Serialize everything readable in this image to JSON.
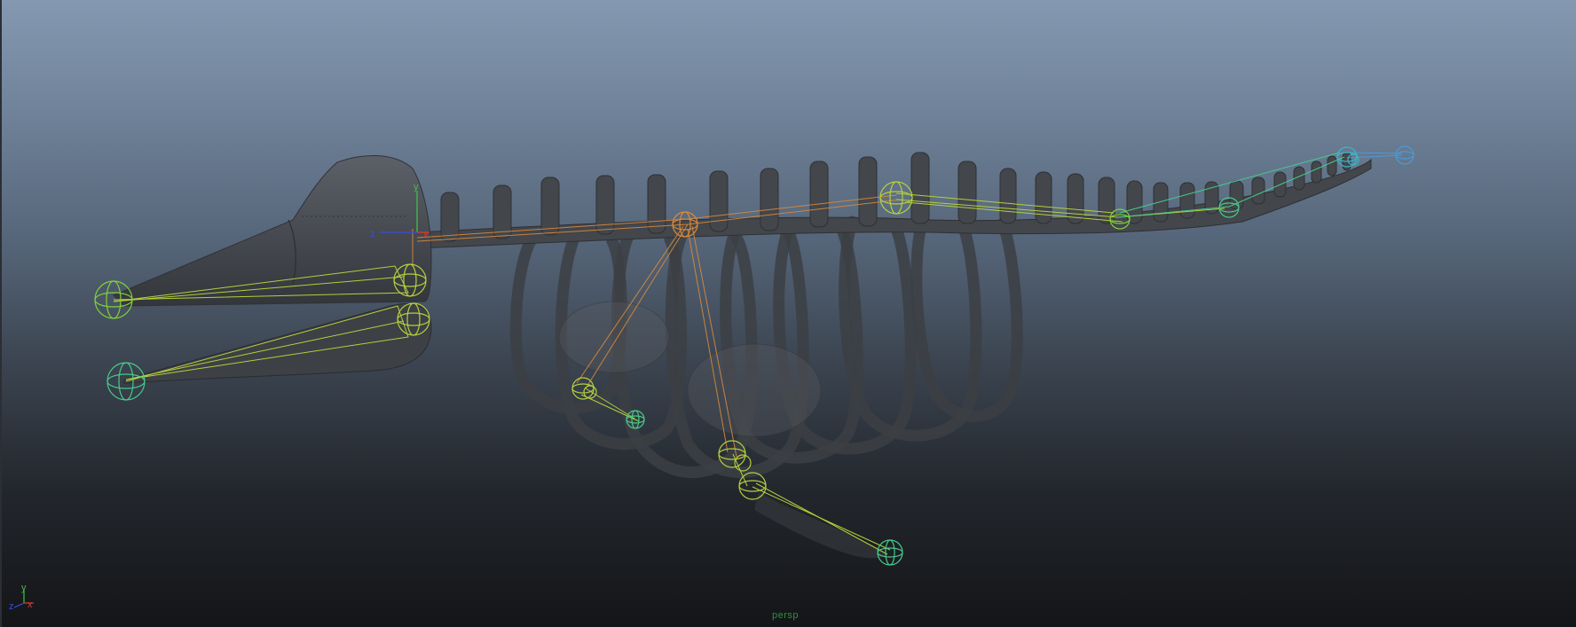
{
  "app": {
    "panel": "viewport",
    "camera_label": "persp"
  },
  "pivot_axes": {
    "z_label": "z",
    "y_label": "y",
    "x_label": "x",
    "colors": {
      "x": "#d83a2c",
      "y": "#3fbf4a",
      "z": "#3a4ed8"
    }
  },
  "view_cube_axes": {
    "y_label": "y",
    "x_label": "x",
    "z_label": "z",
    "colors": {
      "x": "#d83a2c",
      "y": "#3fbf4a",
      "z": "#3a4ed8"
    }
  },
  "colors": {
    "background_top": "#8499b1",
    "background_bottom": "#141518",
    "bone_mesh": "#45484d",
    "joint_yellow": "#b5cf3d",
    "joint_green": "#47c98a",
    "joint_blue": "#4a9ad8",
    "joint_orange": "#d88a3c"
  }
}
